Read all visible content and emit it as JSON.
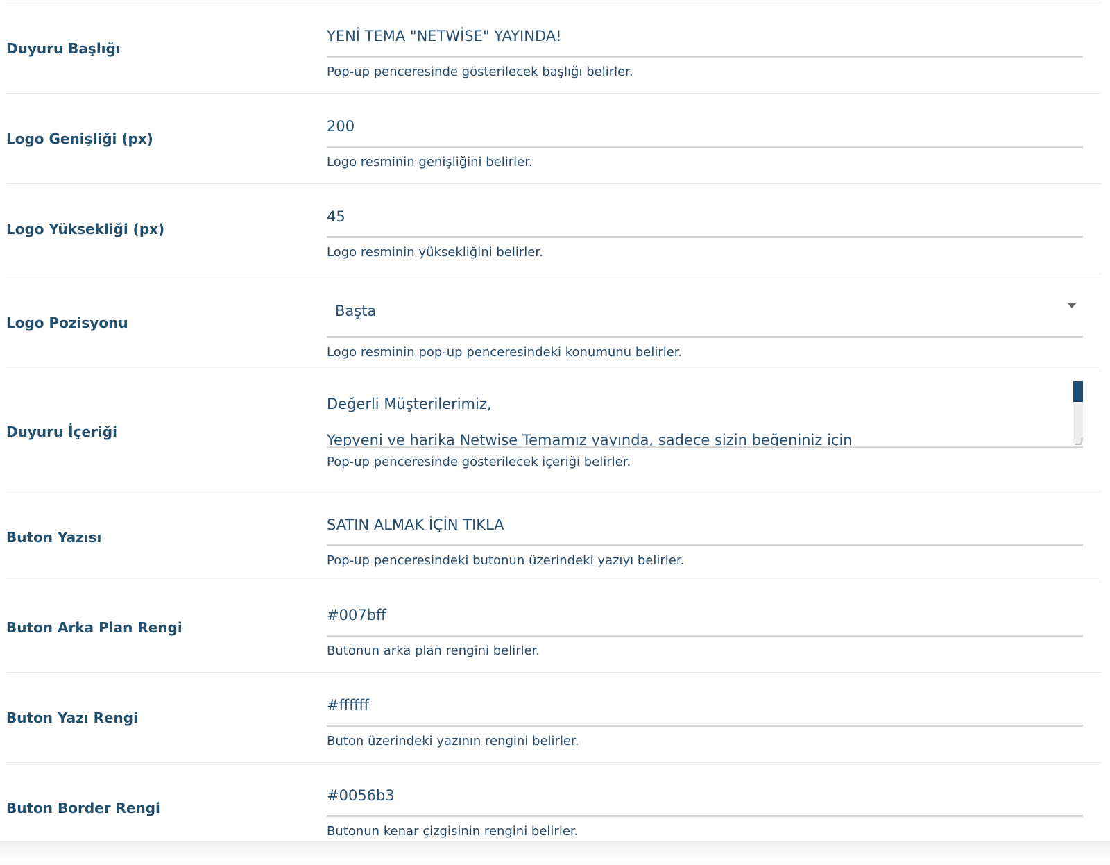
{
  "fields": [
    {
      "label": "Duyuru Başlığı",
      "value": "YENİ TEMA \"NETWİSE\" YAYINDA!",
      "help": "Pop-up penceresinde gösterilecek başlığı belirler."
    },
    {
      "label": "Logo Genişliği (px)",
      "value": "200",
      "help": "Logo resminin genişliğini belirler."
    },
    {
      "label": "Logo Yüksekliği (px)",
      "value": "45",
      "help": "Logo resminin yüksekliğini belirler."
    },
    {
      "label": "Logo Pozisyonu",
      "value": "Başta",
      "help": "Logo resminin pop-up penceresindeki konumunu belirler."
    },
    {
      "label": "Duyuru İçeriği",
      "value_line1": "Değerli Müşterilerimiz,",
      "value_line2": "Yepyeni ve harika Netwise Temamız yayında, sadece sizin beğeniniz için",
      "help": "Pop-up penceresinde gösterilecek içeriği belirler."
    },
    {
      "label": "Buton Yazısı",
      "value": "SATIN ALMAK İÇİN TIKLA",
      "help": "Pop-up penceresindeki butonun üzerindeki yazıyı belirler."
    },
    {
      "label": "Buton Arka Plan Rengi",
      "value": "#007bff",
      "help": "Butonun arka plan rengini belirler."
    },
    {
      "label": "Buton Yazı Rengi",
      "value": "#ffffff",
      "help": "Buton üzerindeki yazının rengini belirler."
    },
    {
      "label": "Buton Border Rengi",
      "value": "#0056b3",
      "help": "Butonun kenar çizgisinin rengini belirler."
    }
  ],
  "icons": {
    "select_caret": "caret-down-icon",
    "resize": "resize-handle-icon"
  },
  "colors": {
    "label": "#224f6e",
    "text": "#274f72",
    "underline": "#d6d6d6",
    "scroll_thumb": "#1f4f72"
  }
}
